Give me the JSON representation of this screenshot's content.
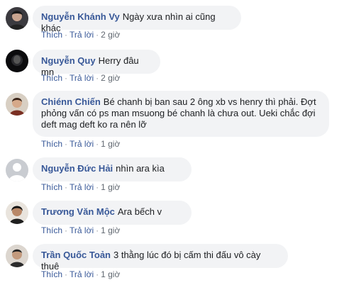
{
  "comments": [
    {
      "author": "Nguyễn Khánh Vy",
      "text": "Ngày xưa nhìn ai cũng khác",
      "like": "Thích",
      "reply": "Trả lời",
      "sep": "·",
      "time": "2 giờ"
    },
    {
      "author": "Nguyễn Quy",
      "text": "Herry đâu mn",
      "like": "Thích",
      "reply": "Trả lời",
      "sep": "·",
      "time": "2 giờ"
    },
    {
      "author": "Chiénn Chiến",
      "text": "Bé chanh bị ban sau 2 ông xb vs henry thì phải. Đợt phỏng vấn có ps man msuong bé chanh là chưa out. Ueki chắc đợi deft mag deft ko ra nên lỡ",
      "like": "Thích",
      "reply": "Trả lời",
      "sep": "·",
      "time": "1 giờ"
    },
    {
      "author": "Nguyễn Đức Hải",
      "text": "nhìn ara kìa",
      "like": "Thích",
      "reply": "Trả lời",
      "sep": "·",
      "time": "1 giờ"
    },
    {
      "author": "Trương Văn Mộc",
      "text": "Ara bếch v",
      "like": "Thích",
      "reply": "Trả lời",
      "sep": "·",
      "time": "1 giờ"
    },
    {
      "author": "Trần Quốc Toản",
      "text": "3 thằng lúc đó bị cấm thi đấu vô cày thuê",
      "like": "Thích",
      "reply": "Trả lời",
      "sep": "·",
      "time": "1 giờ"
    }
  ],
  "colors": {
    "link": "#385898",
    "bubble": "#f2f3f5",
    "meta": "#606770"
  }
}
